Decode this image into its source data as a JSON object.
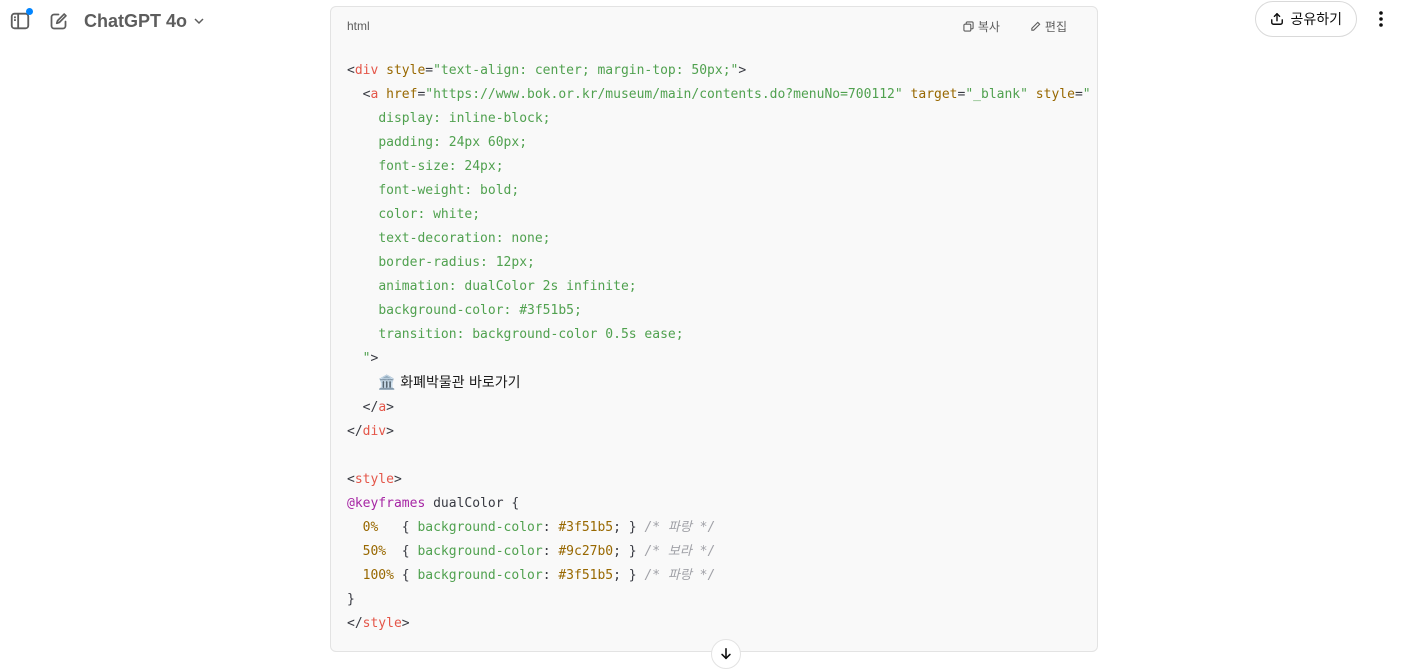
{
  "header": {
    "model_name": "ChatGPT 4o",
    "share_label": "공유하기",
    "icons": [
      "sidebar-toggle-icon",
      "new-chat-icon",
      "chevron-down-icon",
      "share-icon",
      "more-vertical-icon"
    ],
    "notification_color": "#0285ff"
  },
  "codeblock": {
    "language": "html",
    "copy_label": "복사",
    "edit_label": "편집",
    "link_text": "🏛️ 화폐박물관 바로가기",
    "css_lines": [
      "display: inline-block;",
      "padding: 24px 60px;",
      "font-size: 24px;",
      "font-weight: bold;",
      "color: white;",
      "text-decoration: none;",
      "border-radius: 12px;",
      "animation: dualColor 2s infinite;",
      "background-color: #3f51b5;",
      "transition: background-color 0.5s ease;"
    ],
    "keyframes": [
      {
        "pct": "0%  ",
        "color": "#3f51b5",
        "comment": "/* 파랑 */"
      },
      {
        "pct": "50% ",
        "color": "#9c27b0",
        "comment": "/* 보라 */"
      },
      {
        "pct": "100%",
        "color": "#3f51b5",
        "comment": "/* 파랑 */"
      }
    ]
  }
}
